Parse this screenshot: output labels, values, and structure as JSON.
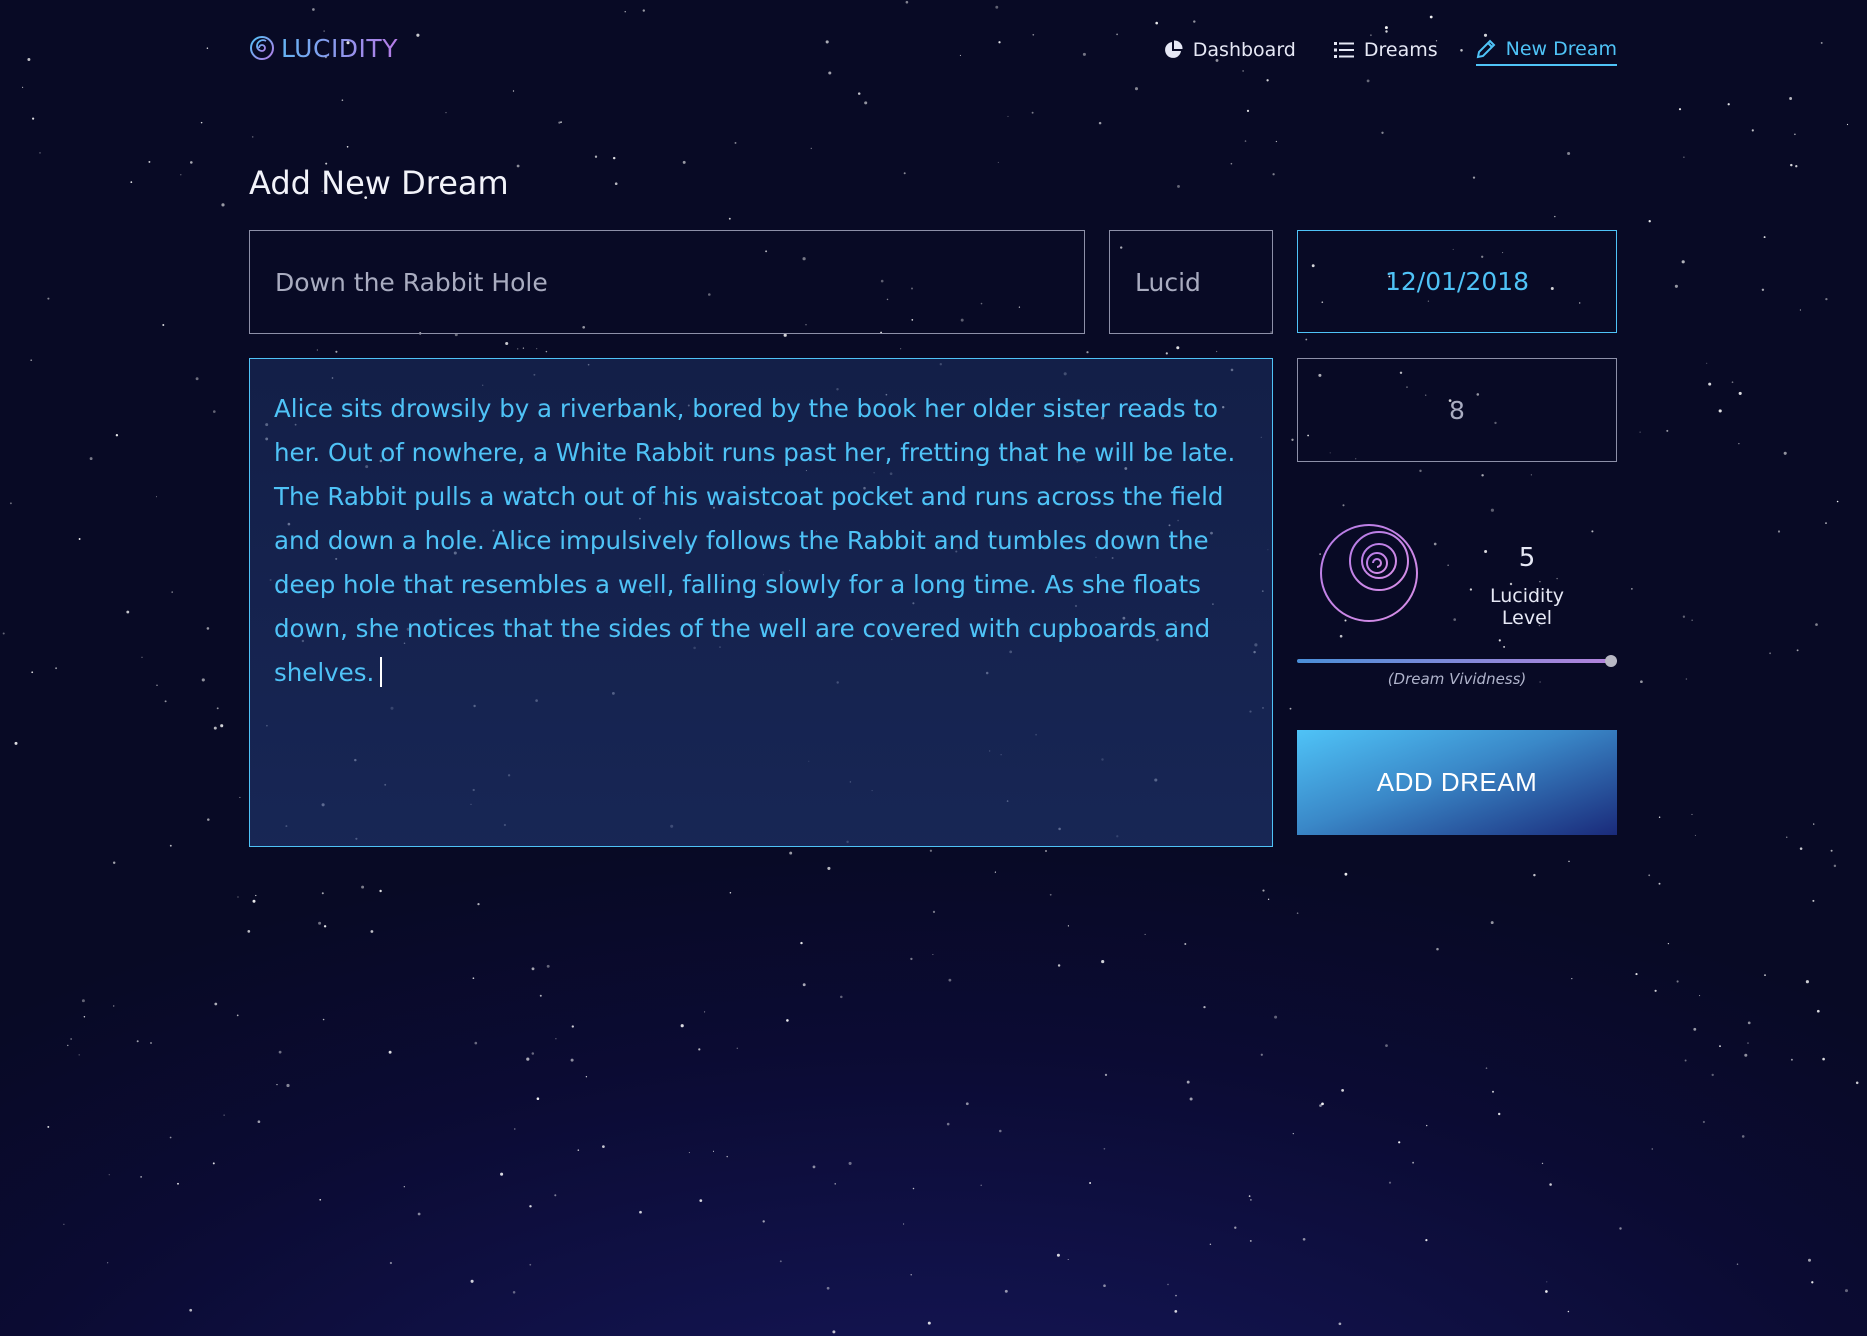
{
  "app": {
    "name": "LUCIDITY",
    "logo_icon": "spiral-logo-icon"
  },
  "nav": {
    "items": [
      {
        "label": "Dashboard",
        "icon": "pie-chart-icon",
        "active": false
      },
      {
        "label": "Dreams",
        "icon": "list-icon",
        "active": false
      },
      {
        "label": "New Dream",
        "icon": "pencil-icon",
        "active": true
      }
    ]
  },
  "page": {
    "title": "Add New Dream"
  },
  "form": {
    "title_value": "Down the Rabbit Hole",
    "type_value": "Lucid",
    "date_value": "12/01/2018",
    "rating_value": "8",
    "story_value": "Alice sits drowsily by a riverbank, bored by the book her older sister reads to her. Out of nowhere, a White Rabbit runs past her, fretting that he will be late. The Rabbit pulls a watch out of his waistcoat pocket and runs across the field and down a hole. Alice impulsively follows the Rabbit and tumbles down the deep hole that resembles a well, falling slowly for a long time. As she floats down, she notices that the sides of the well are covered with cupboards and shelves.",
    "lucidity_value": "5",
    "lucidity_label": "Lucidity Level",
    "vividness_caption": "(Dream Vividness)",
    "vividness_fraction": 0.98,
    "submit_label": "ADD DREAM"
  },
  "colors": {
    "accent": "#4fc3f7",
    "accent_purple": "#b57be6",
    "background": "#0b0b33"
  }
}
